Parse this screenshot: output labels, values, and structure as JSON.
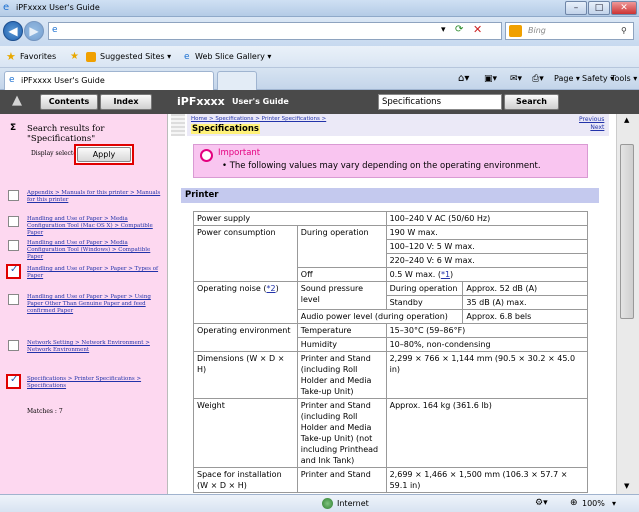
{
  "window": {
    "title": "iPFxxxx User's Guide"
  },
  "address": {
    "search_placeholder": "Bing"
  },
  "favorites": {
    "favorites_label": "Favorites",
    "suggested": "Suggested Sites ▾",
    "webslice": "Web Slice Gallery ▾"
  },
  "tab": {
    "label": "iPFxxxx User's Guide"
  },
  "commands": {
    "page": "Page ▾",
    "safety": "Safety ▾",
    "tools": "Tools ▾"
  },
  "header": {
    "contents": "Contents",
    "index": "Index",
    "brand": "iPFxxxx",
    "brand_sub": "User's Guide",
    "search_value": "Specifications",
    "search_button": "Search"
  },
  "sidebar": {
    "query": "Search results for \"Specifications\"",
    "display_selected": "Display selected topic",
    "apply": "Apply",
    "results": [
      {
        "text": "Appendix > Manuals for this printer > Manuals for this printer",
        "checked": false
      },
      {
        "text": "Handling and Use of Paper > Media Configuration Tool (Mac OS X) > Compatible Paper",
        "checked": false
      },
      {
        "text": "Handling and Use of Paper > Media Configuration Tool (Windows) > Compatible Paper",
        "checked": false
      },
      {
        "text": "Handling and Use of Paper > Paper > Types of Paper",
        "checked": true
      },
      {
        "text": "Handling and Use of Paper > Paper > Using Paper Other Than Genuine Paper and feed confirmed Paper",
        "checked": false
      },
      {
        "text": "Network Setting > Network Environment > Network Environment",
        "checked": false
      },
      {
        "text": "Specifications > Printer Specifications > Specifications",
        "checked": true
      }
    ],
    "matches": "Matches : 7"
  },
  "content": {
    "breadcrumb": "Home > Specifications > Printer Specifications >",
    "title": "Specifications",
    "previous": "Previous",
    "next": "Next",
    "important_head": "Important",
    "important_text": "• The following values may vary depending on the operating environment.",
    "section": "Printer",
    "rows": {
      "power_supply": "Power supply",
      "power_supply_v": "100–240 V AC (50/60 Hz)",
      "power_cons": "Power consumption",
      "during_op": "During operation",
      "pc_190": "190 W max.",
      "pc_5": "100–120 V: 5 W max.",
      "pc_6": "220–240 V: 6 W max.",
      "off": "Off",
      "off_v": "0.5 W max. (",
      "off_note": "*1",
      "noise": "Operating noise (",
      "noise_note": "*2",
      "spl": "Sound pressure level",
      "n_during": "During operation",
      "n_during_v": "Approx. 52 dB (A)",
      "standby": "Standby",
      "standby_v": "35 dB (A) max.",
      "apl": "Audio power level (during operation)",
      "apl_v": "Approx. 6.8 bels",
      "env": "Operating environment",
      "temp": "Temperature",
      "temp_v": "15–30°C (59–86°F)",
      "hum": "Humidity",
      "hum_v": "10–80%, non-condensing",
      "dims": "Dimensions (W × D × H)",
      "dims_d": "Printer and Stand (including Roll Holder and Media Take-up Unit)",
      "dims_v": "2,299 × 766 × 1,144 mm (90.5 × 30.2 × 45.0 in)",
      "weight": "Weight",
      "weight_d": "Printer and Stand (including Roll Holder and Media Take-up Unit) (not including Printhead and Ink Tank)",
      "weight_v": "Approx. 164 kg (361.6 lb)",
      "space": "Space for installation (W × D × H)",
      "space_d": "Printer and Stand",
      "space_v": "2,699 × 1,466 × 1,500 mm (106.3 × 57.7 × 59.1 in)"
    }
  },
  "status": {
    "zone": "Internet",
    "zoom": "100%"
  }
}
